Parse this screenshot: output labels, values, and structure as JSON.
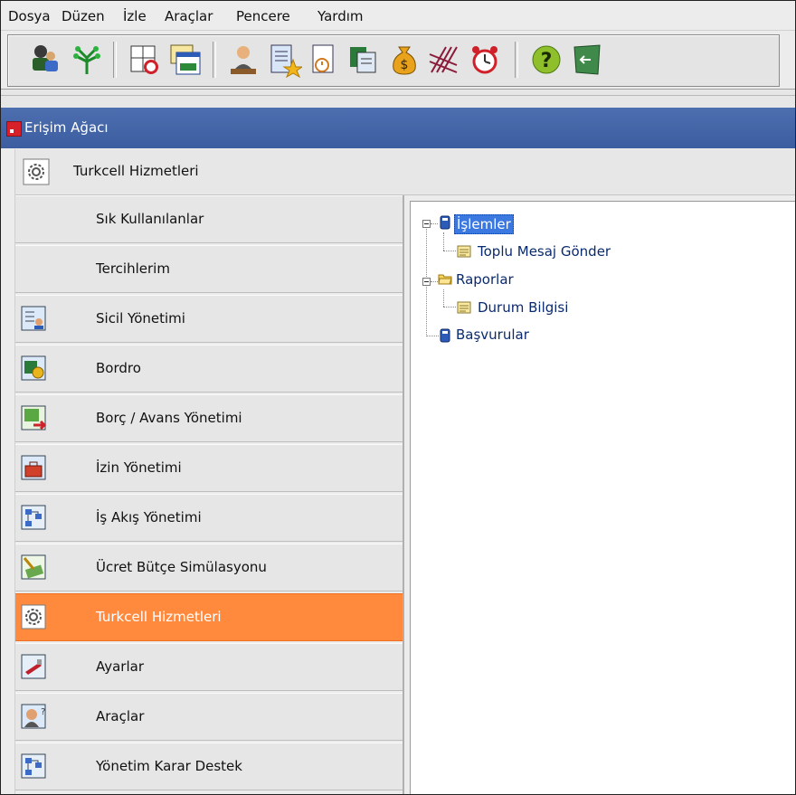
{
  "menu": {
    "items": [
      {
        "label": "Dosya"
      },
      {
        "label": "Düzen"
      },
      {
        "label": "İzle"
      },
      {
        "label": "Araçlar"
      },
      {
        "label": "Pencere"
      },
      {
        "label": "Yardım"
      }
    ]
  },
  "toolbar": {
    "buttons": [
      {
        "icon": "users-group-icon"
      },
      {
        "icon": "org-tree-icon"
      },
      {
        "icon": "calendar-alarm-icon"
      },
      {
        "icon": "window-list-icon"
      },
      {
        "icon": "employee-icon"
      },
      {
        "icon": "document-star-icon"
      },
      {
        "icon": "document-clock-icon"
      },
      {
        "icon": "copy-documents-icon"
      },
      {
        "icon": "money-bag-icon"
      },
      {
        "icon": "hatch-pattern-icon"
      },
      {
        "icon": "alarm-clock-icon"
      },
      {
        "icon": "help-icon"
      },
      {
        "icon": "exit-icon"
      }
    ]
  },
  "panel": {
    "title": "Erişim Ağacı",
    "header": "Turkcell Hizmetleri"
  },
  "sidebar": {
    "items": [
      {
        "label": "Sık Kullanılanlar",
        "icon": ""
      },
      {
        "label": "Tercihlerim",
        "icon": ""
      },
      {
        "label": "Sicil Yönetimi",
        "icon": "personnel-record-icon"
      },
      {
        "label": "Bordro",
        "icon": "payroll-icon"
      },
      {
        "label": "Borç / Avans Yönetimi",
        "icon": "debt-advance-icon"
      },
      {
        "label": "İzin Yönetimi",
        "icon": "leave-briefcase-icon"
      },
      {
        "label": "İş Akış Yönetimi",
        "icon": "workflow-icon"
      },
      {
        "label": "Ücret Bütçe Simülasyonu",
        "icon": "budget-money-icon"
      },
      {
        "label": "Turkcell Hizmetleri",
        "icon": "gear-icon",
        "active": true
      },
      {
        "label": "Ayarlar",
        "icon": "settings-tool-icon"
      },
      {
        "label": "Araçlar",
        "icon": "tools-person-icon"
      },
      {
        "label": "Yönetim Karar Destek",
        "icon": "decision-support-icon"
      }
    ]
  },
  "tree": {
    "nodes": [
      {
        "label": "İşlemler",
        "selected": true,
        "expanded": true
      },
      {
        "label": "Toplu Mesaj Gönder"
      },
      {
        "label": "Raporlar",
        "expanded": true
      },
      {
        "label": "Durum Bilgisi"
      },
      {
        "label": "Başvurular"
      }
    ]
  },
  "colors": {
    "title_bar": "#3c5d9f",
    "active_item": "#ff8a3d",
    "selection": "#3b78e0",
    "tree_text": "#0a2a6e"
  }
}
